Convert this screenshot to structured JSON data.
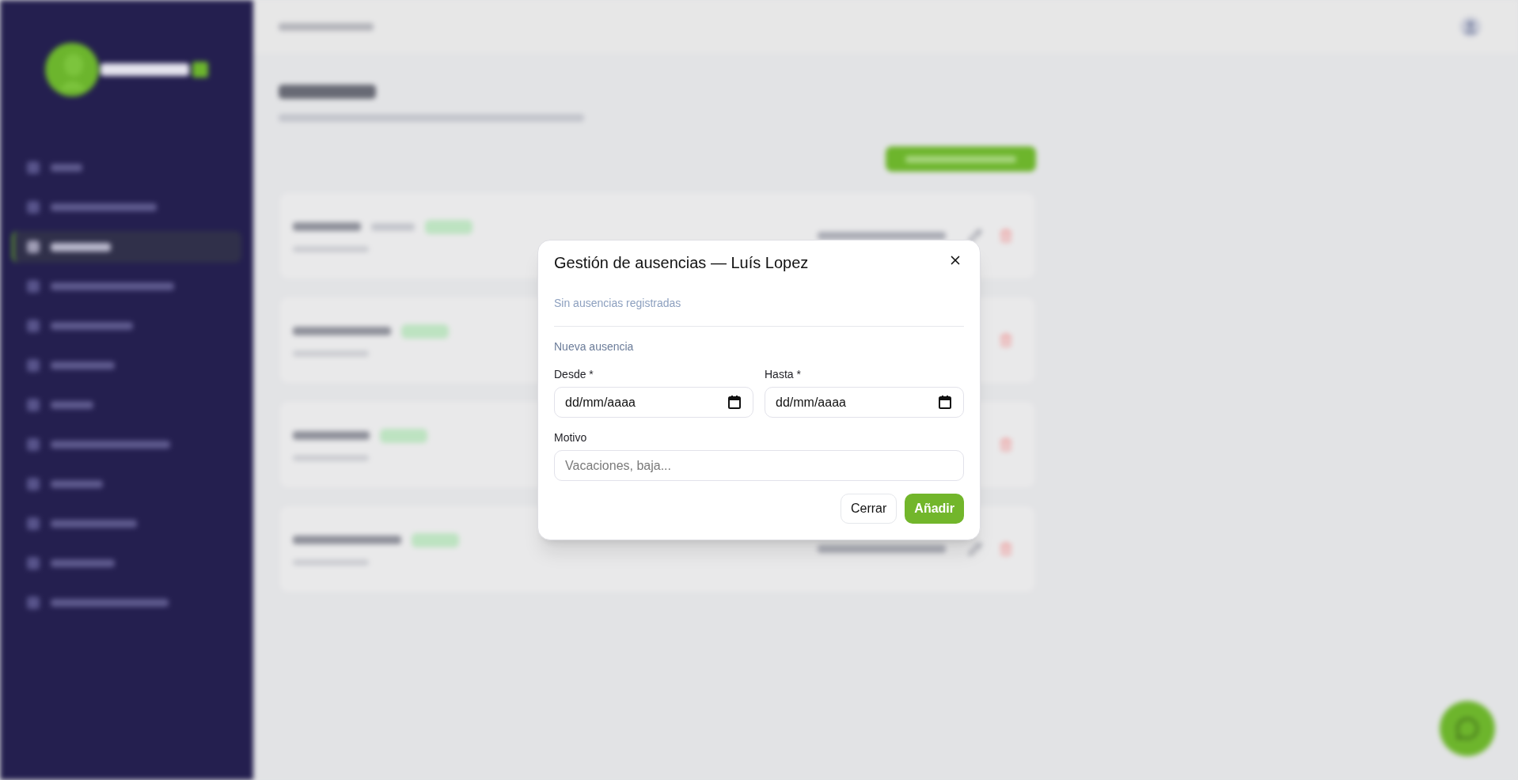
{
  "sidebar": {
    "items": [
      {
        "selected": false
      },
      {
        "selected": false
      },
      {
        "selected": true
      },
      {
        "selected": false
      },
      {
        "selected": false
      },
      {
        "selected": false
      },
      {
        "selected": false
      },
      {
        "selected": false
      },
      {
        "selected": false
      },
      {
        "selected": false
      },
      {
        "selected": false
      },
      {
        "selected": false
      }
    ]
  },
  "dialog": {
    "title": "Gestión de ausencias — Luís Lopez",
    "empty_message": "Sin ausencias registradas",
    "section_title": "Nueva ausencia",
    "fields": [
      {
        "kind": "date",
        "label": "Desde *",
        "placeholder": "dd/mm/aaaa"
      },
      {
        "kind": "date",
        "label": "Hasta *",
        "placeholder": "dd/mm/aaaa"
      },
      {
        "kind": "text",
        "label": "Motivo",
        "placeholder": "Vacaciones, baja..."
      }
    ],
    "buttons": [
      {
        "kind": "secondary",
        "label": "Cerrar"
      },
      {
        "kind": "primary",
        "label": "Añadir"
      }
    ]
  }
}
